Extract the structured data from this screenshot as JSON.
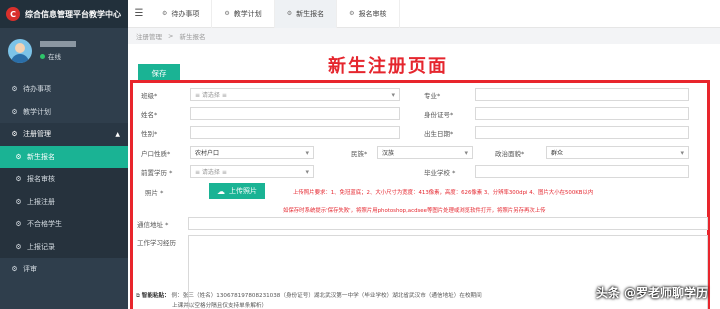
{
  "app": {
    "title": "综合信息管理平台教学中心",
    "logo_letter": "C"
  },
  "user": {
    "status": "在线"
  },
  "sidebar": {
    "items": [
      {
        "label": "待办事项",
        "icon": "gear-icon"
      },
      {
        "label": "教学计划",
        "icon": "gear-icon"
      },
      {
        "label": "注册管理",
        "icon": "gear-icon"
      },
      {
        "label": "新生报名",
        "icon": "gear-icon"
      },
      {
        "label": "报名审核",
        "icon": "gear-icon"
      },
      {
        "label": "上报注册",
        "icon": "gear-icon"
      },
      {
        "label": "不合格学生",
        "icon": "gear-icon"
      },
      {
        "label": "上报记录",
        "icon": "gear-icon"
      },
      {
        "label": "评审",
        "icon": "gear-icon"
      }
    ]
  },
  "topbar": {
    "tabs": [
      {
        "label": "待办事项"
      },
      {
        "label": "教学计划"
      },
      {
        "label": "新生报名"
      },
      {
        "label": "报名审核"
      }
    ]
  },
  "breadcrumb": {
    "parent": "注册管理",
    "current": "新生报名"
  },
  "main": {
    "save_label": "保存",
    "annotation_title": "新生注册页面",
    "upload_label": "上传照片",
    "upload_note_1": "上传照片要求：1、免冠蓝底；2、大小尺寸为宽度：413像素，高度：626像素 3、分辨率300dpi 4、图片大小在500KB以内",
    "upload_note_2": "如保存时系统提示'保存失败'，将照片用photoshop,acdsee等图片处理或浏览软件打开，将照片另存再次上传"
  },
  "form": {
    "class_label": "班级*",
    "class_placeholder": "≡ 请选择 ≡",
    "major_label": "专业*",
    "name_label": "姓名*",
    "idcard_label": "身份证号*",
    "gender_label": "性别*",
    "birth_label": "出生日期*",
    "hukou_label": "户口性质*",
    "hukou_value": "农村户口",
    "ethnic_label": "民族*",
    "ethnic_value": "汉族",
    "political_label": "政治面貌*",
    "political_value": "群众",
    "prior_edu_label": "前置学历 *",
    "prior_edu_placeholder": "≡ 请选择 ≡",
    "grad_school_label": "毕业学校 *",
    "photo_label": "照片 *",
    "address_label": "通信地址 *",
    "work_label": "工作学习经历"
  },
  "smart_paste": {
    "label": "智能粘贴：",
    "example": "例：张三（姓名）1306781978082310​38（身份证号）湖北武汉第一中学（毕业学校）湖北省武汉市（通信地址）在校期间",
    "line2": "上课并以空格分隔且仅支持单条解析）"
  },
  "watermark": "头条 @罗老师聊学历"
}
